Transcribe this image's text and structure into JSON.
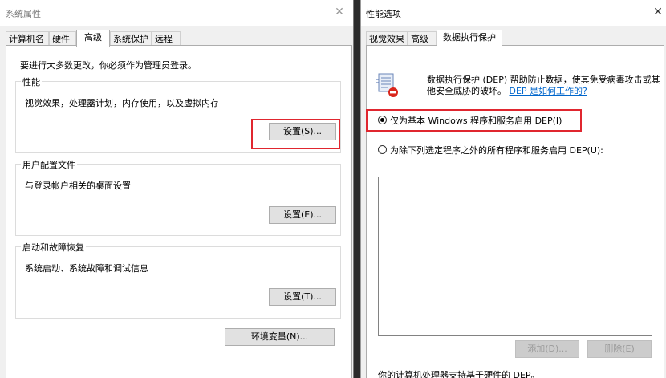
{
  "system_properties": {
    "title": "系统属性",
    "tabs": [
      "计算机名",
      "硬件",
      "高级",
      "系统保护",
      "远程"
    ],
    "active_tab": "高级",
    "admin_note": "要进行大多数更改，你必须作为管理员登录。",
    "performance": {
      "title": "性能",
      "description": "视觉效果，处理器计划，内存使用，以及虚拟内存",
      "button": "设置(S)..."
    },
    "user_profiles": {
      "title": "用户配置文件",
      "description": "与登录帐户相关的桌面设置",
      "button": "设置(E)..."
    },
    "startup_recovery": {
      "title": "启动和故障恢复",
      "description": "系统启动、系统故障和调试信息",
      "button": "设置(T)..."
    },
    "env_button": "环境变量(N)..."
  },
  "performance_options": {
    "title": "性能选项",
    "tabs": [
      "视觉效果",
      "高级",
      "数据执行保护"
    ],
    "active_tab": "数据执行保护",
    "dep_description_line1": "数据执行保护 (DEP) 帮助防止数据，使其免受病毒攻击或其",
    "dep_description_line2": "他安全威胁的破坏。",
    "dep_link": "DEP 是如何工作的?",
    "radio_essential": "仅为基本 Windows 程序和服务启用 DEP(I)",
    "radio_all_except": "为除下列选定程序之外的所有程序和服务启用 DEP(U):",
    "add_button": "添加(D)...",
    "remove_button": "删除(E)",
    "footer_text": "你的计算机处理器支持基于硬件的 DEP。"
  },
  "colors": {
    "highlight_box": "#e0262f",
    "link": "#0066cc"
  }
}
